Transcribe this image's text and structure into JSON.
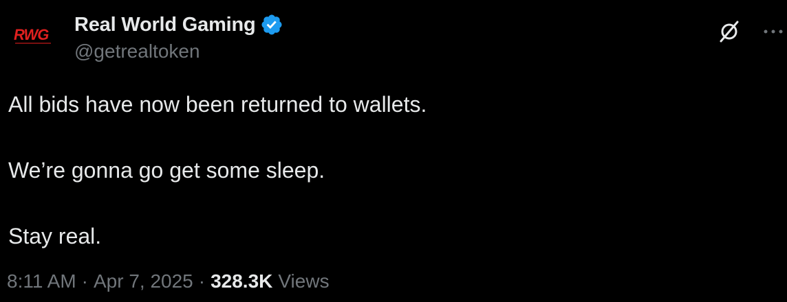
{
  "author": {
    "display_name": "Real World Gaming",
    "handle": "@getrealtoken",
    "avatar_text": "RWG",
    "verified": true,
    "verified_color": "#1d9bf0",
    "avatar_color": "#e0201f"
  },
  "actions": {
    "grok_icon": "grok-icon",
    "more_icon": "more-icon"
  },
  "tweet": {
    "lines": [
      "All bids have now been returned to wallets.",
      "",
      "We’re gonna go get some sleep.",
      "",
      "Stay real."
    ]
  },
  "meta": {
    "time": "8:11 AM",
    "separator": "·",
    "date": "Apr 7, 2025",
    "views_count": "328.3K",
    "views_label": "Views"
  }
}
